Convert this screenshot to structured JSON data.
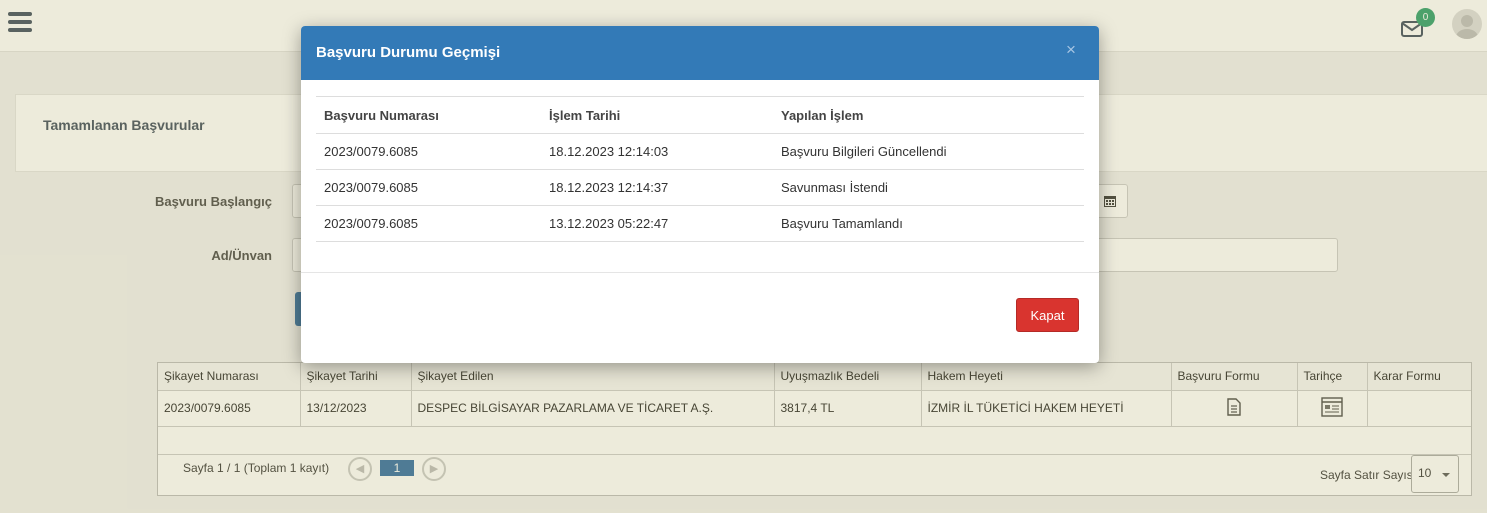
{
  "topbar": {
    "notification_count": "0"
  },
  "panel": {
    "title": "Tamamlanan Başvurular"
  },
  "filters": {
    "start_label": "Başvuru Başlangıç",
    "name_label": "Ad/Ünvan"
  },
  "grid": {
    "headers": [
      "Şikayet Numarası",
      "Şikayet Tarihi",
      "Şikayet Edilen",
      "Uyuşmazlık Bedeli",
      "Hakem Heyeti",
      "Başvuru Formu",
      "Tarihçe",
      "Karar Formu"
    ],
    "rows": [
      {
        "number": "2023/0079.6085",
        "date": "13/12/2023",
        "respondent": "DESPEC BİLGİSAYAR PAZARLAMA VE TİCARET A.Ş.",
        "amount": "3817,4 TL",
        "committee": "İZMİR İL TÜKETİCİ HAKEM HEYETİ"
      }
    ],
    "pager": {
      "info": "Sayfa 1 / 1 (Toplam 1 kayıt)",
      "current_page": "1",
      "page_size_label": "Sayfa Satır Sayısı",
      "page_size": "10"
    }
  },
  "modal": {
    "title": "Başvuru Durumu Geçmişi",
    "close_symbol": "×",
    "headers": [
      "Başvuru Numarası",
      "İşlem Tarihi",
      "Yapılan İşlem"
    ],
    "rows": [
      {
        "number": "2023/0079.6085",
        "date": "18.12.2023 12:14:03",
        "action": "Başvuru Bilgileri Güncellendi"
      },
      {
        "number": "2023/0079.6085",
        "date": "18.12.2023 12:14:37",
        "action": "Savunması İstendi"
      },
      {
        "number": "2023/0079.6085",
        "date": "13.12.2023 05:22:47",
        "action": "Başvuru Tamamlandı"
      }
    ],
    "close_button": "Kapat"
  },
  "colors": {
    "modal_header": "#337ab7",
    "close_button": "#d9342f",
    "accent": "#2d6aa3",
    "badge": "#2a9d6b"
  }
}
